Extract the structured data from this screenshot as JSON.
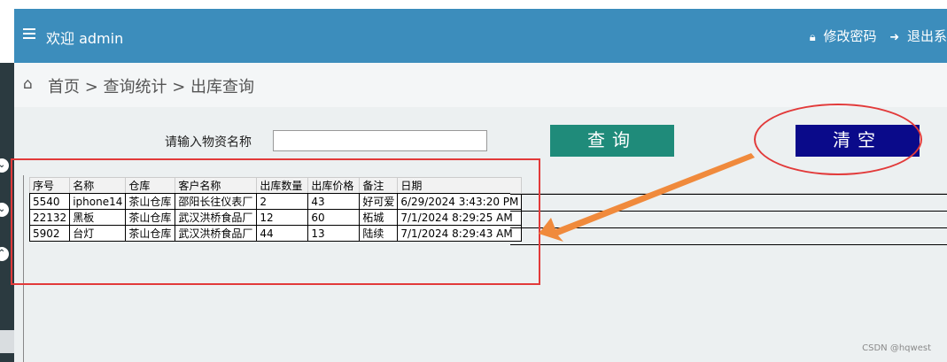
{
  "topbar": {
    "welcome": "欢迎 admin",
    "change_password": "修改密码",
    "logout": "退出系",
    "icons": [
      "menu-icon",
      "lock-icon",
      "exit-icon"
    ]
  },
  "breadcrumb": {
    "text": "首页 > 查询统计 > 出库查询"
  },
  "search": {
    "label": "请输入物资名称",
    "value": "",
    "placeholder": ""
  },
  "buttons": {
    "query": "查询",
    "clear": "清空"
  },
  "table": {
    "columns": [
      "序号",
      "名称",
      "仓库",
      "客户名称",
      "出库数量",
      "出库价格",
      "备注",
      "日期"
    ],
    "rows": [
      [
        "5540",
        "iphone14",
        "茶山仓库",
        "邵阳长往仪表厂",
        "2",
        "43",
        "好可爱",
        "6/29/2024 3:43:20 PM"
      ],
      [
        "22132",
        "黑板",
        "茶山仓库",
        "武汉洪桥食品厂",
        "12",
        "60",
        "柘城",
        "7/1/2024 8:29:25 AM"
      ],
      [
        "5902",
        "台灯",
        "茶山仓库",
        "武汉洪桥食品厂",
        "44",
        "13",
        "陆续",
        "7/1/2024 8:29:43 AM"
      ]
    ]
  },
  "annotations": {
    "box_color": "#e23a3a",
    "arrow_color": "#f08a3c"
  },
  "watermark": "CSDN @hqwest",
  "colors": {
    "topbar": "#3c8dbc",
    "query_button": "#1f8b7a",
    "clear_button": "#0a0a8a",
    "sidebar": "#2b3a40"
  }
}
